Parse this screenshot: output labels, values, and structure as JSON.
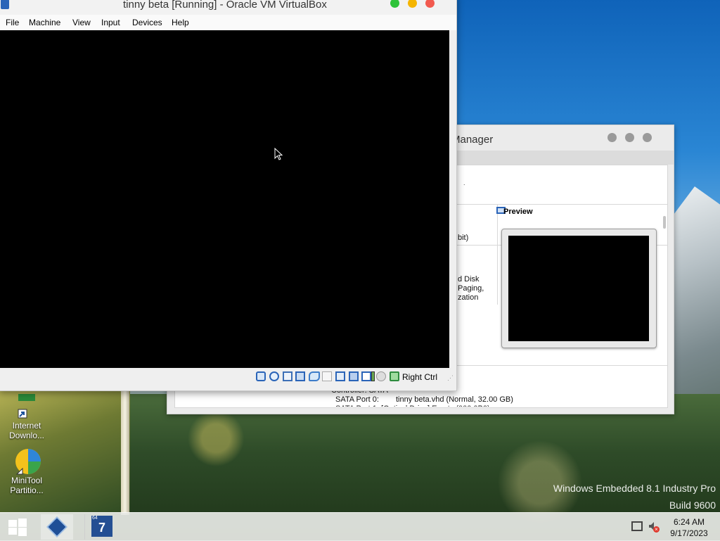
{
  "desktop": {
    "watermark": {
      "line1": "Windows Embedded 8.1 Industry Pro",
      "line2": "Build 9600"
    },
    "icons": [
      {
        "label_line1": "Internet",
        "label_line2": "Downlo..."
      },
      {
        "label_line1": "MiniTool",
        "label_line2": "Partitio..."
      }
    ]
  },
  "vm_window": {
    "title": "tinny beta [Running] - Oracle VM VirtualBox",
    "menu": [
      "File",
      "Machine",
      "View",
      "Input",
      "Devices",
      "Help"
    ],
    "status_bar": {
      "host_key": "Right Ctrl"
    }
  },
  "manager_window": {
    "title_fragment": "Manager",
    "general_fragment": "bit)",
    "system_fragments": [
      "d Disk",
      "Paging,",
      "zation"
    ],
    "preview_label": "Preview",
    "storage": {
      "controller": "Controller: SATA",
      "port0_label": "SATA Port 0:",
      "port0_value": "tinny beta.vhd (Normal, 32.00 GB)",
      "port1_partial": "SATA Port 1:   [Optical Drive] Empty (000.0B0)"
    }
  },
  "taskbar": {
    "clock_time": "6:24 AM",
    "clock_date": "9/17/2023",
    "seven_zip_badge": "64",
    "seven_zip_glyph": "7"
  },
  "colors": {
    "traffic_close": "#f25a4f",
    "traffic_minimize": "#f5b500",
    "traffic_maximize": "#2fc33a",
    "vbox_blue": "#2a64b8"
  }
}
